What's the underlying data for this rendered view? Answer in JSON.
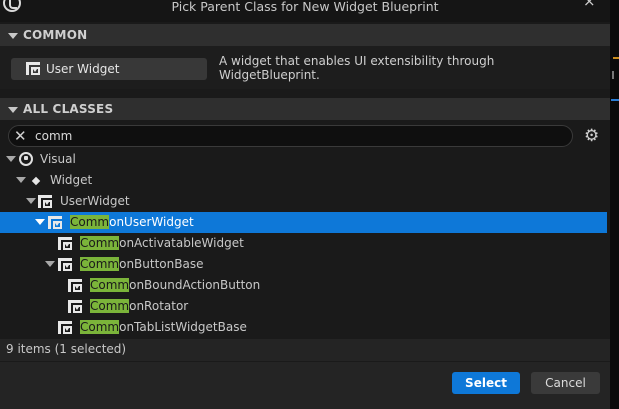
{
  "window": {
    "title": "Pick Parent Class for New Widget Blueprint",
    "close_glyph": "×"
  },
  "common": {
    "header": "COMMON",
    "button_label": "User Widget",
    "description": "A widget that enables UI extensibility through WidgetBlueprint."
  },
  "all_classes": {
    "header": "ALL CLASSES",
    "search_value": "comm",
    "clear_glyph": "✕",
    "settings_glyph": "⚙"
  },
  "tree": [
    {
      "label": "Visual",
      "match": "",
      "rest": "",
      "icon": "visual-icon"
    },
    {
      "label": "Widget",
      "match": "",
      "rest": "",
      "icon": "widget-diamond-icon"
    },
    {
      "label": "UserWidget",
      "match": "",
      "rest": "",
      "icon": "user-widget-icon"
    },
    {
      "label": "",
      "match": "Comm",
      "rest": "onUserWidget",
      "icon": "user-widget-icon",
      "selected": true
    },
    {
      "label": "",
      "match": "Comm",
      "rest": "onActivatableWidget",
      "icon": "user-widget-icon"
    },
    {
      "label": "",
      "match": "Comm",
      "rest": "onButtonBase",
      "icon": "user-widget-icon"
    },
    {
      "label": "",
      "match": "Comm",
      "rest": "onBoundActionButton",
      "icon": "user-widget-icon"
    },
    {
      "label": "",
      "match": "Comm",
      "rest": "onRotator",
      "icon": "user-widget-icon"
    },
    {
      "label": "",
      "match": "Comm",
      "rest": "onTabListWidgetBase",
      "icon": "user-widget-icon"
    }
  ],
  "footer": {
    "count_text": "9 items (1 selected)",
    "select_label": "Select",
    "cancel_label": "Cancel"
  },
  "colors": {
    "selection": "#0e78d8",
    "match_highlight": "#7bb43a",
    "primary_button": "#0e78d8"
  }
}
